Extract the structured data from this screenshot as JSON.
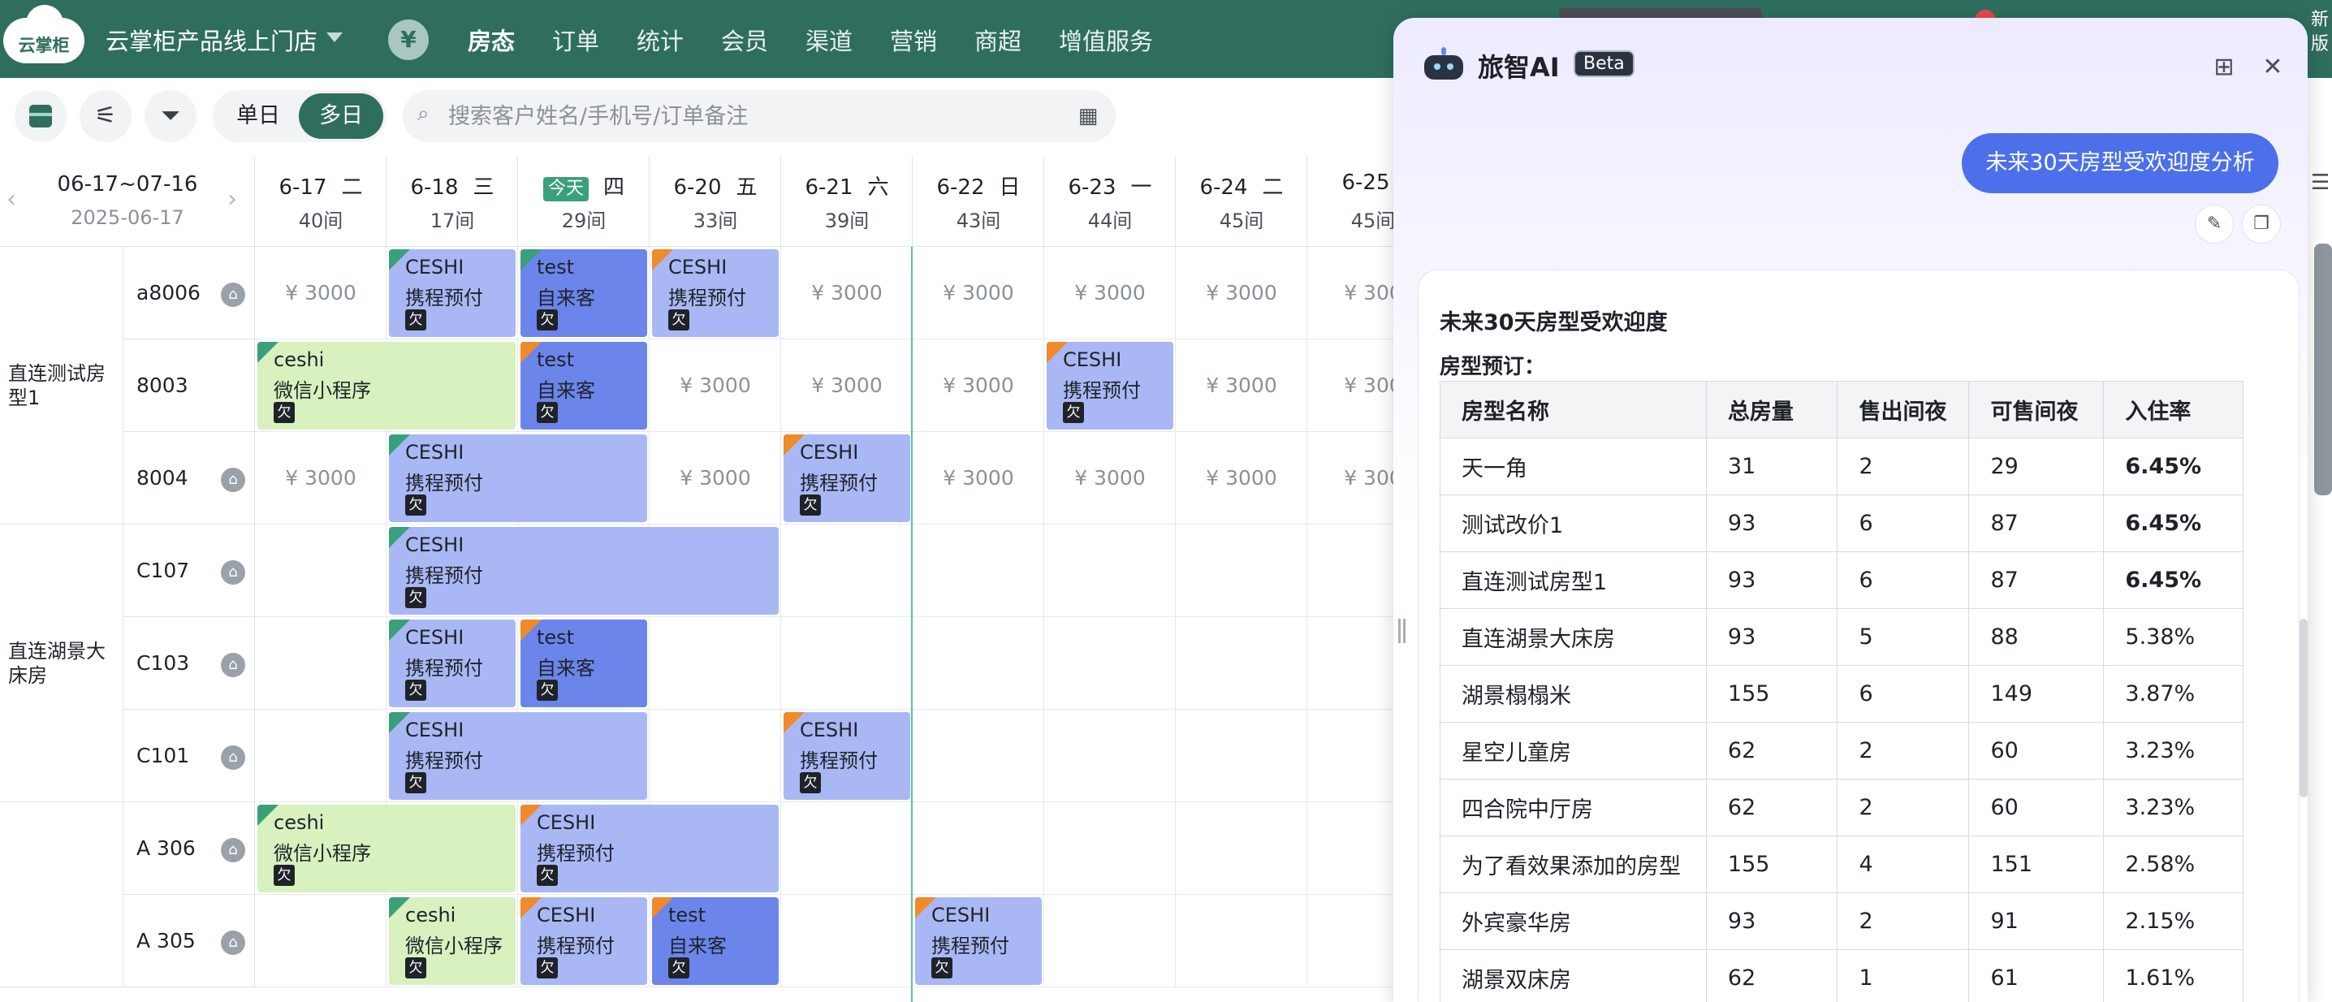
{
  "app": {
    "logo_text": "云掌柜",
    "store_name": "云掌柜产品线上门店",
    "currency_symbol": "¥",
    "nav": [
      "房态",
      "订单",
      "统计",
      "会员",
      "渠道",
      "营销",
      "商超",
      "增值服务"
    ],
    "active_nav": "房态",
    "right_edge_text": "新版"
  },
  "toolbar": {
    "view_modes": [
      "单日",
      "多日"
    ],
    "active_mode": "多日",
    "search_placeholder": "搜索客户姓名/手机号/订单备注"
  },
  "calendar": {
    "range": "06-17~07-16",
    "today_date": "2025-06-17",
    "prev_arrow": "‹",
    "next_arrow": "›",
    "today_label": "今天",
    "days": [
      {
        "date": "6-17",
        "weekday": "二",
        "avail": "40间"
      },
      {
        "date": "6-18",
        "weekday": "三",
        "avail": "17间"
      },
      {
        "date": "",
        "weekday": "四",
        "avail": "29间",
        "is_today": true
      },
      {
        "date": "6-20",
        "weekday": "五",
        "avail": "33间"
      },
      {
        "date": "6-21",
        "weekday": "六",
        "avail": "39间"
      },
      {
        "date": "6-22",
        "weekday": "日",
        "avail": "43间"
      },
      {
        "date": "6-23",
        "weekday": "一",
        "avail": "44间"
      },
      {
        "date": "6-24",
        "weekday": "二",
        "avail": "45间"
      },
      {
        "date": "6-25",
        "weekday": "",
        "avail": "45间"
      }
    ],
    "room_types": [
      {
        "name": "直连测试房型1",
        "rooms": [
          "a8006",
          "8003",
          "8004"
        ]
      },
      {
        "name": "直连湖景大床房",
        "rooms": [
          "C107",
          "C103",
          "C101"
        ]
      },
      {
        "name": "",
        "rooms": [
          "A 306",
          "A 305"
        ]
      }
    ],
    "price_text": "¥ 3000",
    "price_cut_text": "¥ 300",
    "owe_label": "欠",
    "bookings": [
      {
        "row": 0,
        "col": 1,
        "span": 1,
        "name": "CESHI",
        "source": "携程预付",
        "style": "ctrip",
        "flag": "green"
      },
      {
        "row": 0,
        "col": 2,
        "span": 1,
        "name": "test",
        "source": "自来客",
        "style": "walk",
        "flag": "green"
      },
      {
        "row": 0,
        "col": 3,
        "span": 1,
        "name": "CESHI",
        "source": "携程预付",
        "style": "ctrip",
        "flag": "orange"
      },
      {
        "row": 1,
        "col": 0,
        "span": 2,
        "name": "ceshi",
        "source": "微信小程序",
        "style": "wx",
        "flag": "green"
      },
      {
        "row": 1,
        "col": 2,
        "span": 1,
        "name": "test",
        "source": "自来客",
        "style": "walk",
        "flag": "orange"
      },
      {
        "row": 1,
        "col": 6,
        "span": 1,
        "name": "CESHI",
        "source": "携程预付",
        "style": "ctrip",
        "flag": "orange"
      },
      {
        "row": 2,
        "col": 1,
        "span": 2,
        "name": "CESHI",
        "source": "携程预付",
        "style": "ctrip",
        "flag": "green"
      },
      {
        "row": 2,
        "col": 4,
        "span": 1,
        "name": "CESHI",
        "source": "携程预付",
        "style": "ctrip",
        "flag": "orange"
      },
      {
        "row": 3,
        "col": 1,
        "span": 3,
        "name": "CESHI",
        "source": "携程预付",
        "style": "ctrip",
        "flag": "green"
      },
      {
        "row": 4,
        "col": 1,
        "span": 1,
        "name": "CESHI",
        "source": "携程预付",
        "style": "ctrip",
        "flag": "green"
      },
      {
        "row": 4,
        "col": 2,
        "span": 1,
        "name": "test",
        "source": "自来客",
        "style": "walk",
        "flag": "orange"
      },
      {
        "row": 5,
        "col": 1,
        "span": 2,
        "name": "CESHI",
        "source": "携程预付",
        "style": "ctrip",
        "flag": "green"
      },
      {
        "row": 5,
        "col": 4,
        "span": 1,
        "name": "CESHI",
        "source": "携程预付",
        "style": "ctrip",
        "flag": "orange"
      },
      {
        "row": 6,
        "col": 0,
        "span": 2,
        "name": "ceshi",
        "source": "微信小程序",
        "style": "wx",
        "flag": "green"
      },
      {
        "row": 6,
        "col": 2,
        "span": 2,
        "name": "CESHI",
        "source": "携程预付",
        "style": "ctrip",
        "flag": "orange"
      },
      {
        "row": 7,
        "col": 1,
        "span": 1,
        "name": "ceshi",
        "source": "微信小程序",
        "style": "wx",
        "flag": "green"
      },
      {
        "row": 7,
        "col": 2,
        "span": 1,
        "name": "CESHI",
        "source": "携程预付",
        "style": "ctrip",
        "flag": "orange"
      },
      {
        "row": 7,
        "col": 3,
        "span": 1,
        "name": "test",
        "source": "自来客",
        "style": "walk",
        "flag": "orange"
      },
      {
        "row": 7,
        "col": 5,
        "span": 1,
        "name": "CESHI",
        "source": "携程预付",
        "style": "ctrip",
        "flag": "orange"
      }
    ],
    "price_cells": [
      [
        0,
        0
      ],
      [
        0,
        4
      ],
      [
        0,
        5
      ],
      [
        0,
        6
      ],
      [
        0,
        7
      ],
      [
        0,
        8
      ],
      [
        1,
        3
      ],
      [
        1,
        4
      ],
      [
        1,
        5
      ],
      [
        1,
        7
      ],
      [
        1,
        8
      ],
      [
        2,
        0
      ],
      [
        2,
        3
      ],
      [
        2,
        5
      ],
      [
        2,
        6
      ],
      [
        2,
        7
      ],
      [
        2,
        8
      ]
    ]
  },
  "ai_panel": {
    "title": "旅智AI",
    "beta": "Beta",
    "user_question": "未来30天房型受欢迎度分析",
    "answer_title": "未来30天房型受欢迎度",
    "answer_subtitle": "房型预订：",
    "table_headers": [
      "房型名称",
      "总房量",
      "售出间夜",
      "可售间夜",
      "入住率"
    ],
    "table_rows": [
      {
        "name": "天一角",
        "total": "31",
        "sold": "2",
        "avail": "29",
        "rate": "6.45%",
        "bold": true
      },
      {
        "name": "测试改价1",
        "total": "93",
        "sold": "6",
        "avail": "87",
        "rate": "6.45%",
        "bold": true
      },
      {
        "name": "直连测试房型1",
        "total": "93",
        "sold": "6",
        "avail": "87",
        "rate": "6.45%",
        "bold": true
      },
      {
        "name": "直连湖景大床房",
        "total": "93",
        "sold": "5",
        "avail": "88",
        "rate": "5.38%",
        "bold": false
      },
      {
        "name": "湖景榻榻米",
        "total": "155",
        "sold": "6",
        "avail": "149",
        "rate": "3.87%",
        "bold": false
      },
      {
        "name": "星空儿童房",
        "total": "62",
        "sold": "2",
        "avail": "60",
        "rate": "3.23%",
        "bold": false
      },
      {
        "name": "四合院中厅房",
        "total": "62",
        "sold": "2",
        "avail": "60",
        "rate": "3.23%",
        "bold": false
      },
      {
        "name": "为了看效果添加的房型",
        "total": "155",
        "sold": "4",
        "avail": "151",
        "rate": "2.58%",
        "bold": false
      },
      {
        "name": "外宾豪华房",
        "total": "93",
        "sold": "2",
        "avail": "91",
        "rate": "2.15%",
        "bold": false
      },
      {
        "name": "湖景双床房",
        "total": "62",
        "sold": "1",
        "avail": "61",
        "rate": "1.61%",
        "bold": false
      }
    ]
  },
  "colors": {
    "brand": "#2f6e5e",
    "today_line": "#56c4a0",
    "ctrip_booking": "#a9b8f4",
    "walkin_booking": "#6b85ea",
    "wechat_booking": "#d8f1bf",
    "ai_bubble": "#4b70ea"
  }
}
